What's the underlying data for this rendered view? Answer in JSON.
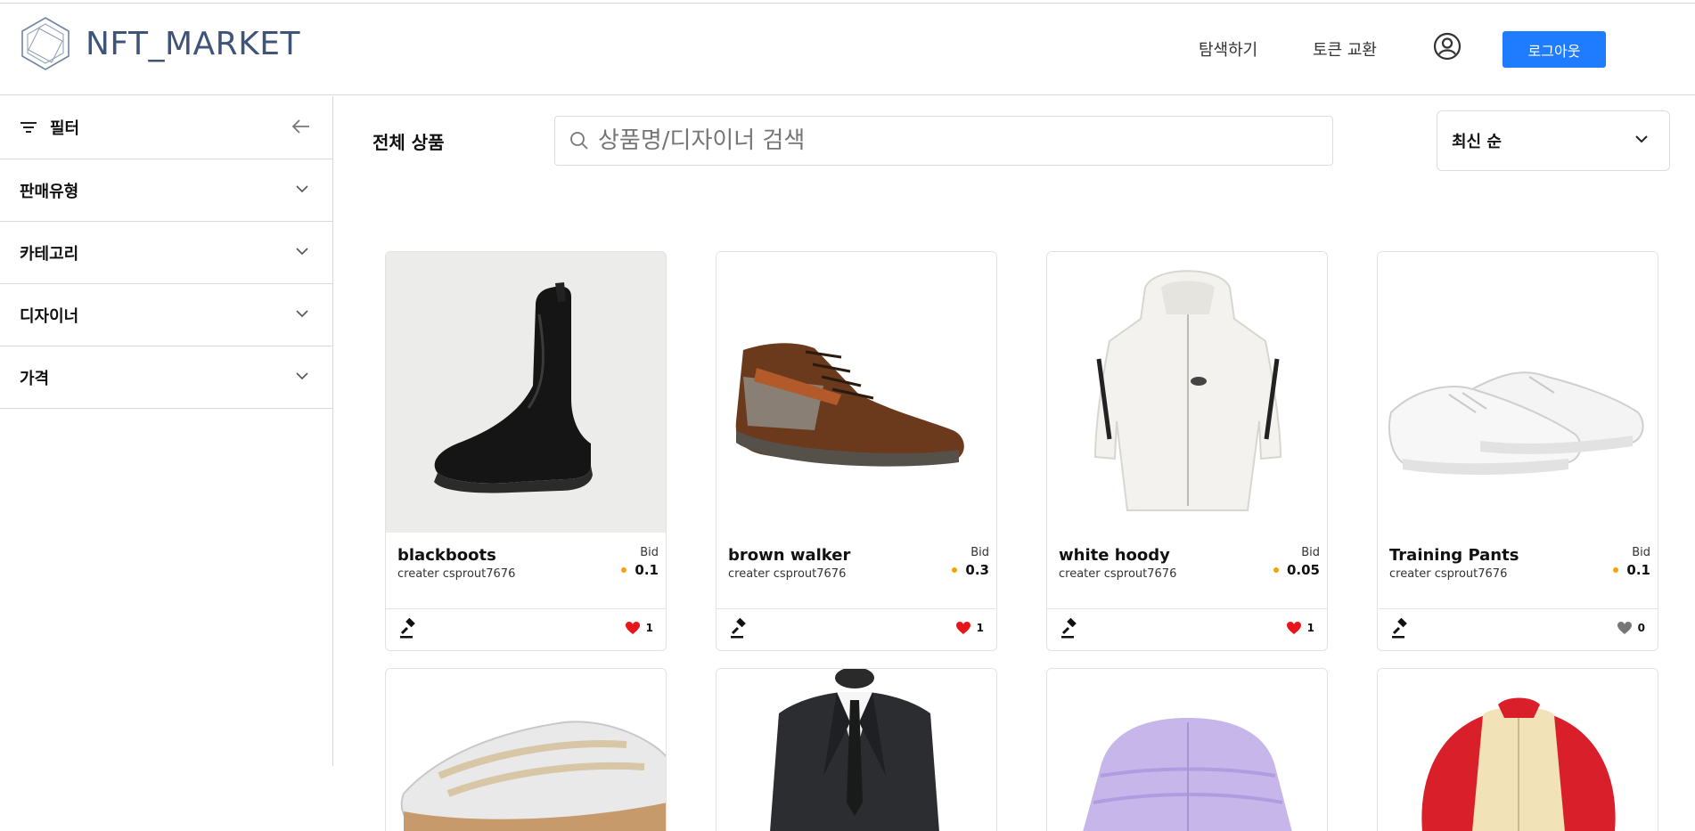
{
  "header": {
    "logo_text": "NFT_MARKET",
    "nav": [
      "탐색하기",
      "토큰 교환"
    ],
    "logout_label": "로그아웃",
    "accent": "#1f7cff"
  },
  "sidebar": {
    "filter_label": "필터",
    "facets": [
      "판매유형",
      "카테고리",
      "디자이너",
      "가격"
    ]
  },
  "main": {
    "title": "전체 상품",
    "search_placeholder": "상품명/디자이너 검색",
    "sort_label": "최신 순"
  },
  "cards": [
    {
      "name": "blackboots",
      "creator": "creater csprout7676",
      "bid_label": "Bid",
      "bid": "0.1",
      "likes": "1",
      "liked": true,
      "image": "black chelsea boot"
    },
    {
      "name": "brown walker",
      "creator": "creater csprout7676",
      "bid_label": "Bid",
      "bid": "0.3",
      "likes": "1",
      "liked": true,
      "image": "brown high-top sneaker"
    },
    {
      "name": "white hoody",
      "creator": "creater csprout7676",
      "bid_label": "Bid",
      "bid": "0.05",
      "likes": "1",
      "liked": true,
      "image": "white fleece hoodie"
    },
    {
      "name": "Training Pants",
      "creator": "creater csprout7676",
      "bid_label": "Bid",
      "bid": "0.1",
      "likes": "0",
      "liked": false,
      "image": "white low sneakers"
    }
  ],
  "row2_images": [
    "grey leather sneakers",
    "dark suit jacket",
    "lilac puffer jacket",
    "red and cream zip jacket"
  ]
}
